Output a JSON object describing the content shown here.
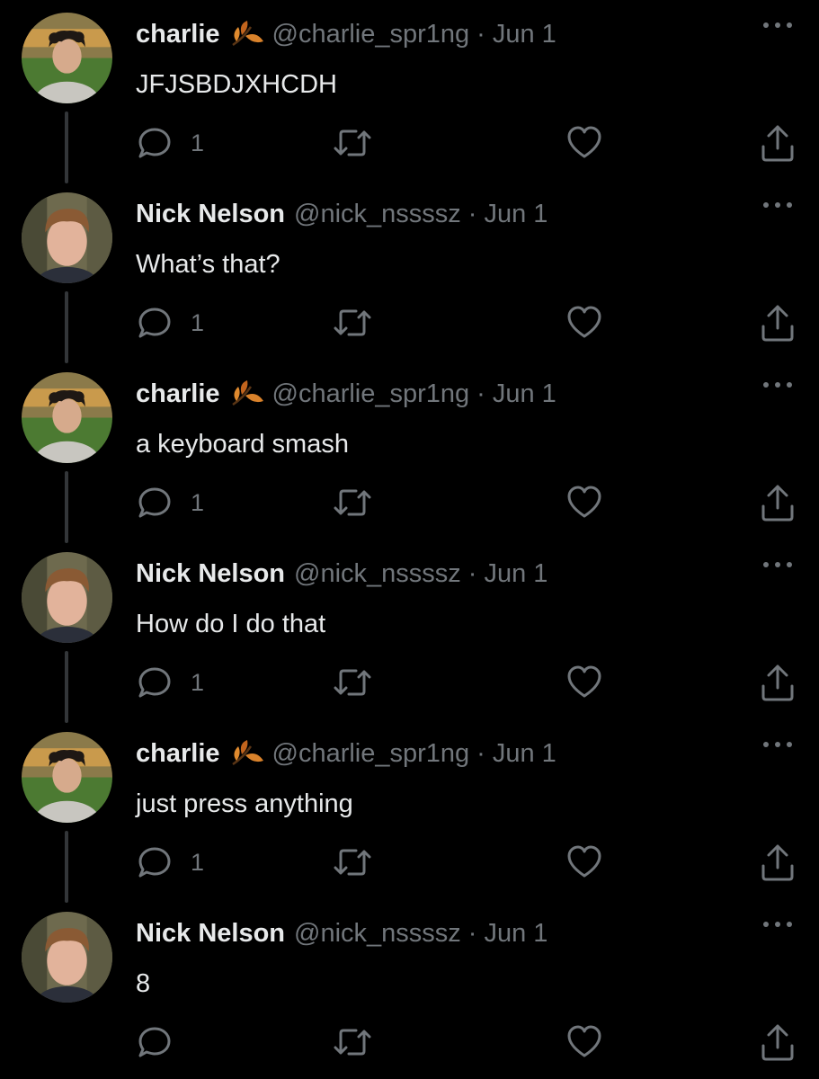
{
  "thread": {
    "tweets": [
      {
        "author": {
          "name": "charlie",
          "handle": "@charlie_spr1ng",
          "avatar": "charlie-avatar",
          "emoji": "leaf-icon"
        },
        "date": "Jun 1",
        "separator": "·",
        "text": "JFJSBDJXHCDH",
        "reply_count": "1",
        "has_thread_line": true
      },
      {
        "author": {
          "name": "Nick Nelson",
          "handle": "@nick_nssssz",
          "avatar": "nick-avatar",
          "emoji": ""
        },
        "date": "Jun 1",
        "separator": "·",
        "text": "What’s that?",
        "reply_count": "1",
        "has_thread_line": true
      },
      {
        "author": {
          "name": "charlie",
          "handle": "@charlie_spr1ng",
          "avatar": "charlie-avatar",
          "emoji": "leaf-icon"
        },
        "date": "Jun 1",
        "separator": "·",
        "text": "a keyboard smash",
        "reply_count": "1",
        "has_thread_line": true
      },
      {
        "author": {
          "name": "Nick Nelson",
          "handle": "@nick_nssssz",
          "avatar": "nick-avatar",
          "emoji": ""
        },
        "date": "Jun 1",
        "separator": "·",
        "text": "How do I do that",
        "reply_count": "1",
        "has_thread_line": true
      },
      {
        "author": {
          "name": "charlie",
          "handle": "@charlie_spr1ng",
          "avatar": "charlie-avatar",
          "emoji": "leaf-icon"
        },
        "date": "Jun 1",
        "separator": "·",
        "text": "just press anything",
        "reply_count": "1",
        "has_thread_line": true
      },
      {
        "author": {
          "name": "Nick Nelson",
          "handle": "@nick_nssssz",
          "avatar": "nick-avatar",
          "emoji": ""
        },
        "date": "Jun 1",
        "separator": "·",
        "text": "8",
        "reply_count": "",
        "has_thread_line": false
      }
    ]
  },
  "icons": {
    "reply": "reply-icon",
    "retweet": "retweet-icon",
    "like": "heart-icon",
    "share": "share-icon",
    "more": "more-icon"
  },
  "colors": {
    "background": "#000000",
    "text": "#e7e9ea",
    "secondary": "#71767b",
    "thread_line": "#333639",
    "leaf": "#d9822b"
  }
}
